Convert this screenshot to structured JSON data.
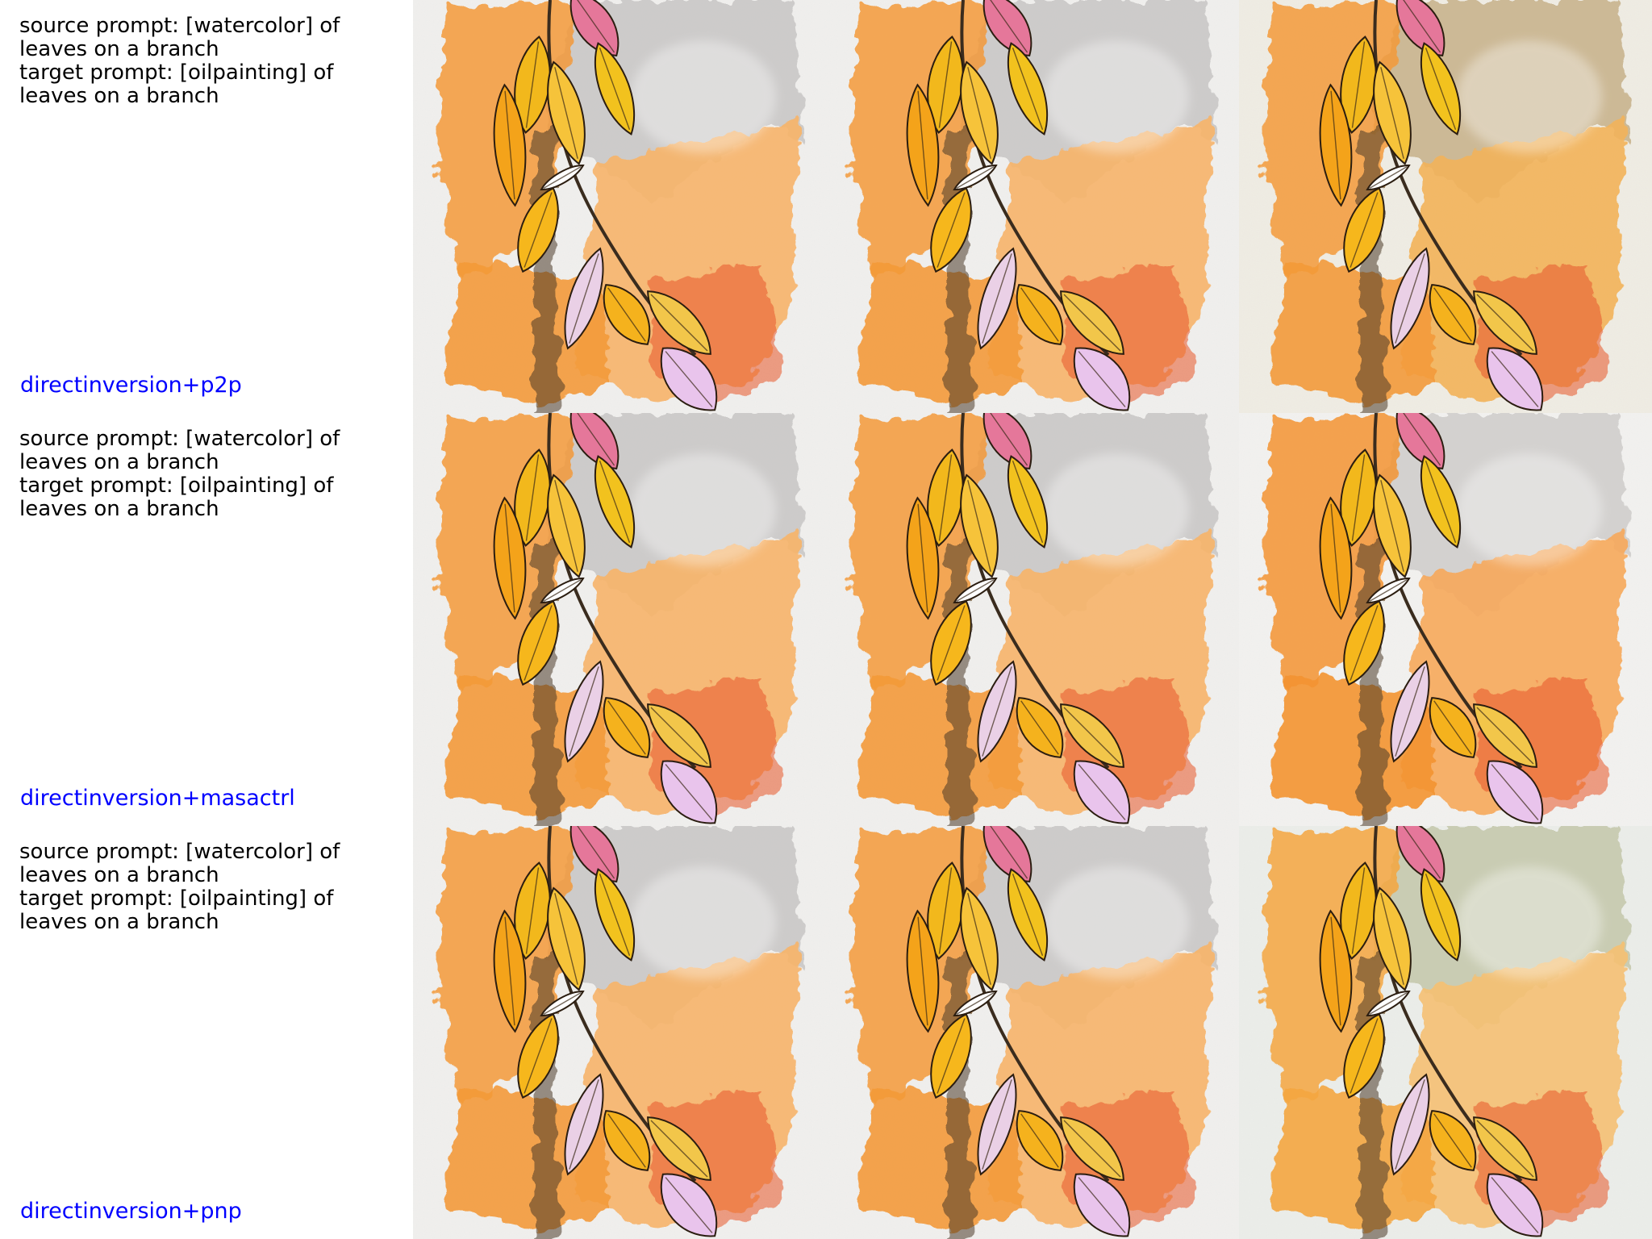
{
  "rows": [
    {
      "source_prompt": "source prompt: [watercolor] of leaves on a branch",
      "target_prompt": "target prompt: [oilpainting] of leaves on a branch",
      "method": "directinversion+p2p",
      "images": [
        "source-image",
        "reconstruction-image",
        "edited-image"
      ]
    },
    {
      "source_prompt": "source prompt: [watercolor] of leaves on a branch",
      "target_prompt": "target prompt: [oilpainting] of leaves on a branch",
      "method": "directinversion+masactrl",
      "images": [
        "source-image",
        "reconstruction-image",
        "edited-image"
      ]
    },
    {
      "source_prompt": "source prompt: [watercolor] of leaves on a branch",
      "target_prompt": "target prompt: [oilpainting] of leaves on a branch",
      "method": "directinversion+pnp",
      "images": [
        "source-image",
        "reconstruction-image",
        "edited-image"
      ]
    }
  ],
  "colors": {
    "method_label": "#0000ff",
    "prompt_text": "#000000",
    "paper": "#f1f0ee",
    "gray_wash": "#c9c8c6",
    "orange_wash": "#f39a3a",
    "leaf_yellow": "#f2b81c",
    "leaf_pink": "#ead0e6",
    "leaf_red": "#e8552a",
    "oil_khaki": "#c9b48e",
    "oil_sage": "#c5c9ad"
  }
}
